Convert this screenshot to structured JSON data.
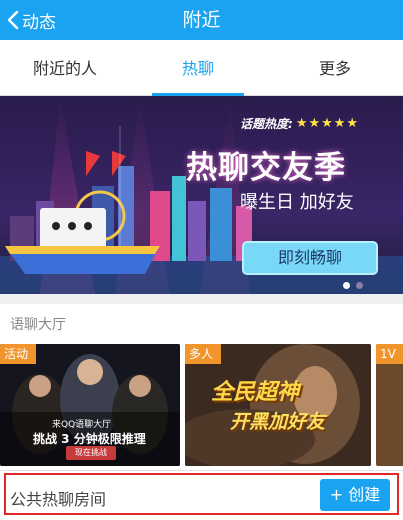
{
  "header": {
    "back_label": "动态",
    "title": "附近"
  },
  "tabs": [
    {
      "label": "附近的人"
    },
    {
      "label": "热聊"
    },
    {
      "label": "更多"
    }
  ],
  "banner": {
    "heat_label": "话题热度:",
    "heat_stars": "★★★★★",
    "title": "热聊交友季",
    "subtitle": "曝生日 加好友",
    "button_label": "即刻畅聊"
  },
  "section": {
    "title": "语聊大厅"
  },
  "cards": [
    {
      "tag": "活动",
      "line1": "来QQ语聊大厅",
      "line2": "挑战 3 分钟极限推理",
      "badge": "现在挑战"
    },
    {
      "tag": "多人",
      "line1": "全民超神",
      "line2": "开黑加好友"
    },
    {
      "tag": "1V"
    }
  ],
  "bottom": {
    "room_label": "公共热聊房间",
    "create_label": "+ 创建"
  },
  "colors": {
    "accent": "#1aa3f0",
    "tag_orange": "#f0942b",
    "highlight": "#e12727"
  }
}
